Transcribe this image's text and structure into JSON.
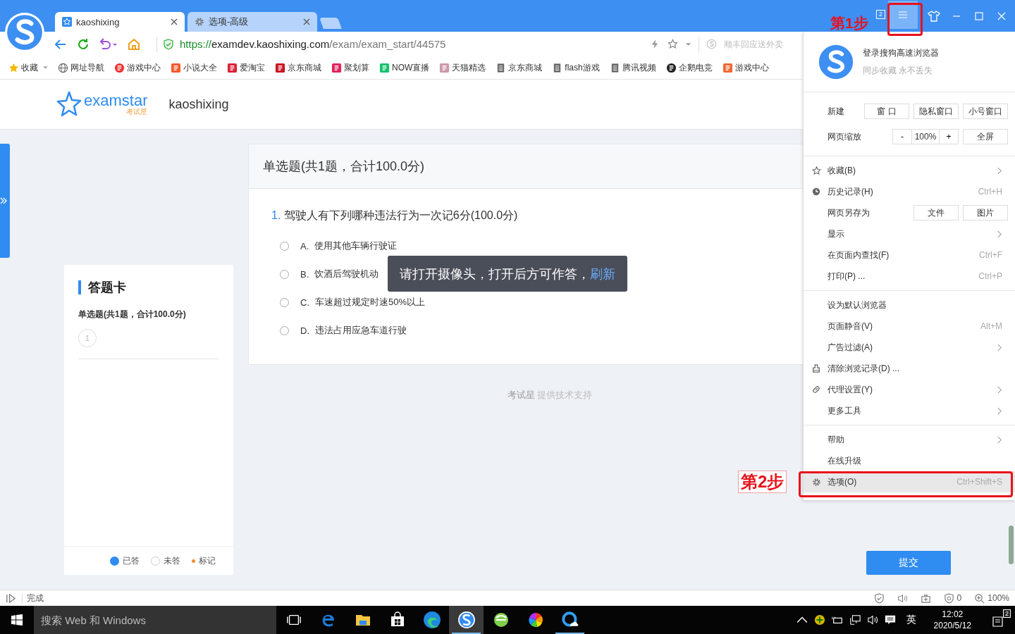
{
  "browser": {
    "tabs": [
      {
        "title": "kaoshixing",
        "selected": true
      },
      {
        "title": "选项-高级",
        "selected": false
      }
    ],
    "window_badge": "2",
    "menu_button": {
      "selected": true
    },
    "address": {
      "scheme": "https://",
      "host": "examdev.kaoshixing.com",
      "path": "/exam/exam_start/44575"
    },
    "search": {
      "placeholder": "顺丰回应送外卖"
    },
    "bookmarks": [
      {
        "label": "收藏",
        "dropdown": true
      },
      {
        "label": "网址导航",
        "dropdown": false
      },
      {
        "label": "游戏中心",
        "dropdown": false
      },
      {
        "label": "小说大全",
        "dropdown": false
      },
      {
        "label": "爱淘宝",
        "dropdown": false
      },
      {
        "label": "京东商城",
        "dropdown": false
      },
      {
        "label": "聚划算",
        "dropdown": false
      },
      {
        "label": "NOW直播",
        "dropdown": false
      },
      {
        "label": "天猫精选",
        "dropdown": false
      },
      {
        "label": "京东商城",
        "dropdown": false
      },
      {
        "label": "flash游戏",
        "dropdown": false
      },
      {
        "label": "腾讯视频",
        "dropdown": false
      },
      {
        "label": "企鹅电竞",
        "dropdown": false
      },
      {
        "label": "游戏中心",
        "dropdown": false
      }
    ]
  },
  "page": {
    "logo": {
      "brand": "examstar",
      "sub": "考试星"
    },
    "site_name": "kaoshixing",
    "question_card": {
      "header": "单选题(共1题，合计100.0分)",
      "number": "1.",
      "question": "驾驶人有下列哪种违法行为一次记6分(100.0分)",
      "options": [
        {
          "letter": "A.",
          "text": "使用其他车辆行驶证",
          "selected": false
        },
        {
          "letter": "B.",
          "text": "饮酒后驾驶机动",
          "selected": false
        },
        {
          "letter": "C.",
          "text": "车速超过规定时速50%以上",
          "selected": false
        },
        {
          "letter": "D.",
          "text": "违法占用应急车道行驶",
          "selected": false
        }
      ]
    },
    "toast": {
      "text": "请打开摄像头，打开后方可作答，",
      "link": "刷新"
    },
    "answer_card": {
      "title": "答题卡",
      "section": "单选题(共1题，合计100.0分)",
      "numbers": [
        {
          "label": "1",
          "answered": false
        }
      ],
      "legend": [
        {
          "kind": "answered",
          "label": "已答"
        },
        {
          "kind": "unanswered",
          "label": "未答"
        },
        {
          "kind": "marked",
          "label": "标记"
        }
      ]
    },
    "footer": {
      "brand": "考试星",
      "text": "提供技术支持"
    },
    "submit": "提交"
  },
  "menu": {
    "account": {
      "title": "登录搜狗高速浏览器",
      "subtitle": "同步收藏 永不丢失"
    },
    "new_row": {
      "label": "新建",
      "buttons": [
        "窗 口",
        "隐私窗口",
        "小号窗口"
      ]
    },
    "zoom_row": {
      "label": "网页缩放",
      "minus": "-",
      "value": "100%",
      "plus": "+",
      "fullscreen": "全屏"
    },
    "sections": [
      {
        "items": [
          {
            "kind": "item",
            "label": "收藏(B)",
            "submenu": true,
            "selected": false
          },
          {
            "kind": "item",
            "label": "历史记录(H)",
            "shortcut": "Ctrl+H",
            "submenu": false,
            "selected": false
          },
          {
            "kind": "buttons",
            "label": "网页另存为",
            "buttons": [
              "文件",
              "图片"
            ]
          },
          {
            "kind": "item",
            "label": "显示",
            "submenu": true,
            "selected": false
          },
          {
            "kind": "item",
            "label": "在页面内查找(F)",
            "shortcut": "Ctrl+F",
            "submenu": false,
            "selected": false
          },
          {
            "kind": "item",
            "label": "打印(P) ...",
            "shortcut": "Ctrl+P",
            "submenu": false,
            "selected": false
          }
        ]
      },
      {
        "items": [
          {
            "kind": "item",
            "label": "设为默认浏览器",
            "submenu": false,
            "selected": false
          },
          {
            "kind": "item",
            "label": "页面静音(V)",
            "shortcut": "Alt+M",
            "submenu": false,
            "selected": false
          },
          {
            "kind": "item",
            "label": "广告过滤(A)",
            "submenu": true,
            "selected": false
          },
          {
            "kind": "item",
            "label": "清除浏览记录(D) ...",
            "submenu": false,
            "selected": false
          },
          {
            "kind": "item",
            "label": "代理设置(Y)",
            "submenu": true,
            "selected": false
          },
          {
            "kind": "item",
            "label": "更多工具",
            "submenu": true,
            "selected": false
          }
        ]
      },
      {
        "items": [
          {
            "kind": "item",
            "label": "帮助",
            "submenu": true,
            "selected": false
          },
          {
            "kind": "item",
            "label": "在线升级",
            "submenu": false,
            "selected": false
          },
          {
            "kind": "item",
            "label": "选项(O)",
            "shortcut": "Ctrl+Shift+S",
            "submenu": false,
            "selected": true
          }
        ]
      }
    ]
  },
  "annotations": [
    {
      "text": "第1步"
    },
    {
      "text": "第2步"
    }
  ],
  "status_bar": {
    "text": "完成",
    "ad_count": "0",
    "zoom": "100%"
  },
  "taskbar": {
    "search": {
      "placeholder": "搜索 Web 和 Windows"
    },
    "apps": [
      {
        "kind": "task-view",
        "selected": false,
        "running": false
      },
      {
        "kind": "edge-legacy",
        "selected": false,
        "running": false
      },
      {
        "kind": "explorer",
        "selected": false,
        "running": false
      },
      {
        "kind": "store",
        "selected": false,
        "running": false
      },
      {
        "kind": "edge",
        "selected": false,
        "running": false
      },
      {
        "kind": "sogou",
        "selected": true,
        "running": true
      },
      {
        "kind": "browser360",
        "selected": false,
        "running": false
      },
      {
        "kind": "pinwheel",
        "selected": false,
        "running": false
      },
      {
        "kind": "cloud",
        "selected": false,
        "running": true
      }
    ],
    "ime": "英",
    "time": "12:02",
    "date": "2020/5/12",
    "notification_badge": "2"
  }
}
